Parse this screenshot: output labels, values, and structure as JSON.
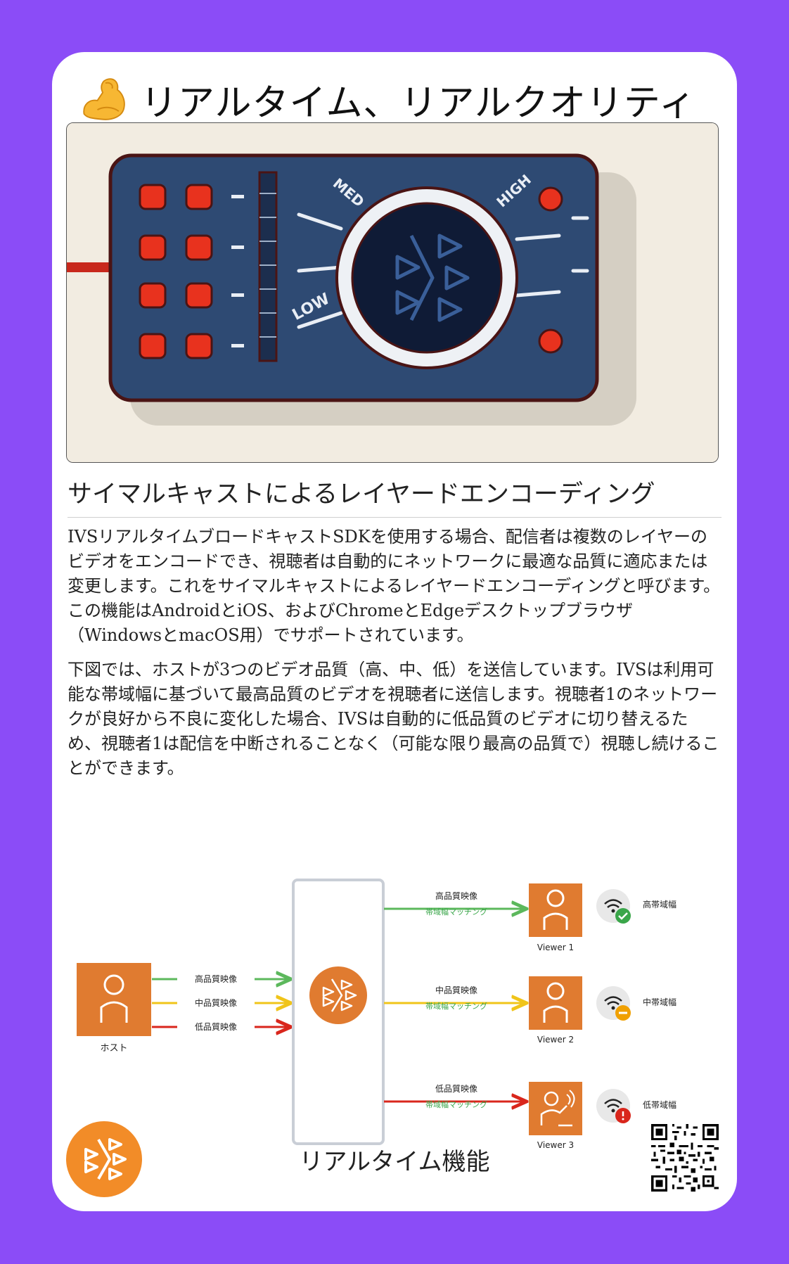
{
  "header": {
    "emoji_icon": "flexed-biceps-icon",
    "title": "リアルタイム、リアルクオリティ"
  },
  "hero_image": {
    "labels": {
      "low": "LOW",
      "med": "MED",
      "high": "HIGH"
    },
    "colors": {
      "panel": "#2e4a73",
      "knob": "#0f1b36",
      "led": "#e8321e",
      "cable": "#c8281c"
    }
  },
  "section": {
    "heading": "サイマルキャストによるレイヤードエンコーディング",
    "paragraph_1": "IVSリアルタイムブロードキャストSDKを使用する場合、配信者は複数のレイヤーのビデオをエンコードでき、視聴者は自動的にネットワークに最適な品質に適応または変更します。これをサイマルキャストによるレイヤードエンコーディングと呼びます。この機能はAndroidとiOS、およびChromeとEdgeデスクトップブラウザ（WindowsとmacOS用）でサポートされています。",
    "paragraph_2": "下図では、ホストが3つのビデオ品質（高、中、低）を送信しています。IVSは利用可能な帯域幅に基づいて最高品質のビデオを視聴者に送信します。視聴者1のネットワークが良好から不良に変化した場合、IVSは自動的に低品質のビデオに切り替えるため、視聴者1は配信を中断されることなく（可能な限り最高の品質で）視聴し続けることができます。"
  },
  "diagram": {
    "host_label": "ホスト",
    "streams": [
      "高品質映像",
      "中品質映像",
      "低品質映像"
    ],
    "viewers": [
      {
        "stream": "高品質映像",
        "match": "帯域幅マッチング",
        "name": "Viewer 1",
        "bandwidth": "高帯域幅",
        "status_icon": "check-icon"
      },
      {
        "stream": "中品質映像",
        "match": "帯域幅マッチング",
        "name": "Viewer 2",
        "bandwidth": "中帯域幅",
        "status_icon": "minus-icon"
      },
      {
        "stream": "低品質映像",
        "match": "帯域幅マッチング",
        "name": "Viewer 3",
        "bandwidth": "低帯域幅",
        "status_icon": "alert-icon"
      }
    ],
    "colors": {
      "high": "#5cb85c",
      "mid": "#f0c419",
      "low": "#d9261c",
      "orange": "#e07b30",
      "match_text": "#3aa64a"
    }
  },
  "footer": {
    "label": "リアルタイム機能",
    "logo_icon": "ivs-logo-icon",
    "qr_icon": "qr-code-icon"
  }
}
